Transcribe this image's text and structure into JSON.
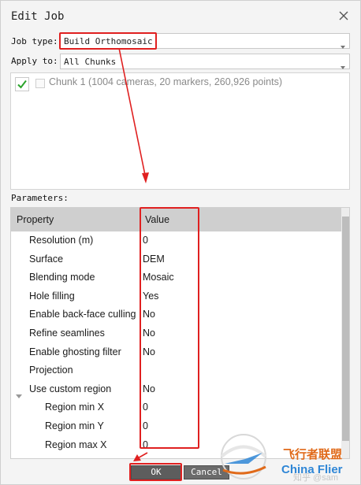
{
  "window": {
    "title": "Edit Job",
    "close_icon": "close-icon"
  },
  "form": {
    "job_type_label": "Job type:",
    "job_type_value": "Build Orthomosaic",
    "apply_to_label": "Apply to:",
    "apply_to_value": "All Chunks"
  },
  "chunks": [
    {
      "label": "Chunk 1 (1004 cameras, 20 markers, 260,926 points)",
      "checked": true
    }
  ],
  "parameters": {
    "label": "Parameters:",
    "headers": {
      "property": "Property",
      "value": "Value"
    },
    "rows": [
      {
        "property": "Resolution (m)",
        "value": "0"
      },
      {
        "property": "Surface",
        "value": "DEM"
      },
      {
        "property": "Blending mode",
        "value": "Mosaic"
      },
      {
        "property": "Hole filling",
        "value": "Yes"
      },
      {
        "property": "Enable back-face culling",
        "value": "No"
      },
      {
        "property": "Refine seamlines",
        "value": "No"
      },
      {
        "property": "Enable ghosting filter",
        "value": "No"
      },
      {
        "property": "Projection",
        "value": ""
      },
      {
        "property": "Use custom region",
        "value": "No",
        "expandable": true
      },
      {
        "property": "Region min X",
        "value": "0",
        "indent": true
      },
      {
        "property": "Region min Y",
        "value": "0",
        "indent": true
      },
      {
        "property": "Region max X",
        "value": "0",
        "indent": true
      }
    ]
  },
  "buttons": {
    "ok": "OK",
    "cancel": "Cancel"
  },
  "watermark": {
    "zhihu": "知乎 @sam",
    "brand_cn": "飞行者联盟",
    "brand_en": "China Flier"
  },
  "colors": {
    "highlight": "#e02020",
    "check": "#2aa32a",
    "header_bg": "#cfcfcf"
  }
}
